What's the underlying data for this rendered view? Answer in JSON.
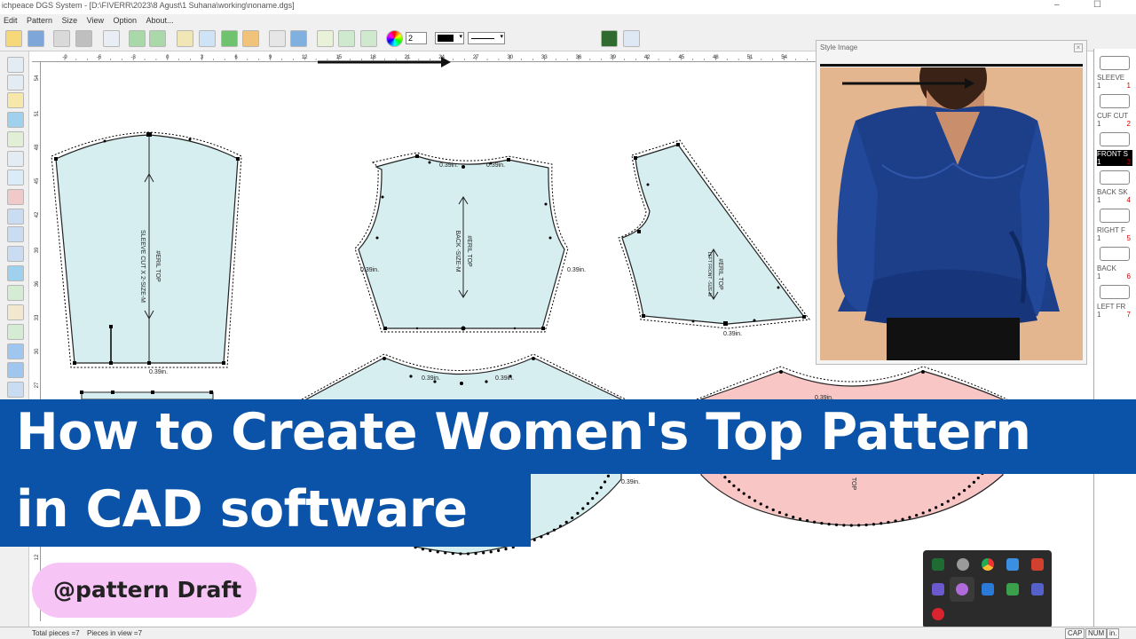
{
  "window": {
    "title": "ichpeace DGS System - [D:\\FIVERR\\2023\\8 Agust\\1 Suhana\\working\\noname.dgs]",
    "minimize": "–",
    "maximize": "☐"
  },
  "menu": {
    "items": [
      "Edit",
      "Pattern",
      "Size",
      "View",
      "Option",
      "About..."
    ]
  },
  "toolbar": {
    "line_width_value": "2"
  },
  "ruler": {
    "h_ticks": [
      "-9",
      "-6",
      "-3",
      "0",
      "3",
      "6",
      "9",
      "12",
      "15",
      "18",
      "21",
      "24",
      "27",
      "30",
      "33",
      "36",
      "39",
      "42",
      "45",
      "48",
      "51",
      "54",
      "57",
      "60",
      "63",
      "66"
    ],
    "v_ticks": [
      "54",
      "51",
      "48",
      "45",
      "42",
      "39",
      "36",
      "33",
      "30",
      "27",
      "12"
    ]
  },
  "pieces": {
    "sleeve": {
      "name": "#ERIL TOP",
      "cut": "SLEEVE CUT X 2-SIZE-M",
      "seam": "0.39in."
    },
    "back": {
      "name": "#ERIL TOP",
      "cut": "BACK -SIZE-M",
      "seam_top_left": "0.39in.",
      "seam_top_right": "0.39in.",
      "seam_left": "0.39in.",
      "seam_right": "0.39in."
    },
    "left_front": {
      "name": "#ERIL TOP",
      "cut": "LEFT FRONT -SIZE-M",
      "seam": "0.39in."
    },
    "skirt_back": {
      "seam1": "0.39in.",
      "seam2": "0.39in.",
      "seam3": "0.39in."
    },
    "skirt_front": {
      "seam1": "0.39in.",
      "label": "TOP"
    }
  },
  "style_window": {
    "title": "Style Image",
    "close": "×"
  },
  "piece_list": [
    {
      "label": "SLEEVE",
      "count": "1",
      "index": "1",
      "active": false
    },
    {
      "label": "CUF CUT",
      "count": "1",
      "index": "2",
      "active": false
    },
    {
      "label": "FRONT S",
      "count": "1",
      "index": "3",
      "active": true
    },
    {
      "label": "BACK SK",
      "count": "1",
      "index": "4",
      "active": false
    },
    {
      "label": "RIGHT F",
      "count": "1",
      "index": "5",
      "active": false
    },
    {
      "label": "BACK",
      "count": "1",
      "index": "6",
      "active": false
    },
    {
      "label": "LEFT FR",
      "count": "1",
      "index": "7",
      "active": false
    }
  ],
  "overlay": {
    "headline_line1": "How to Create Women's Top Pattern",
    "headline_line2": "in CAD software",
    "handle": "@pattern Draft"
  },
  "status": {
    "total": "Total pieces =7",
    "in_view": "Pieces in view =7",
    "cap": "CAP",
    "num": "NUM",
    "unit": "in."
  },
  "colors": {
    "piece_blue": "#d6eef0",
    "piece_pink": "#f9c6c6",
    "banner": "#0a53a8",
    "pill": "#f7c5f5",
    "blouse": "#1d3f8a",
    "skin_bg": "#e3b68f"
  }
}
